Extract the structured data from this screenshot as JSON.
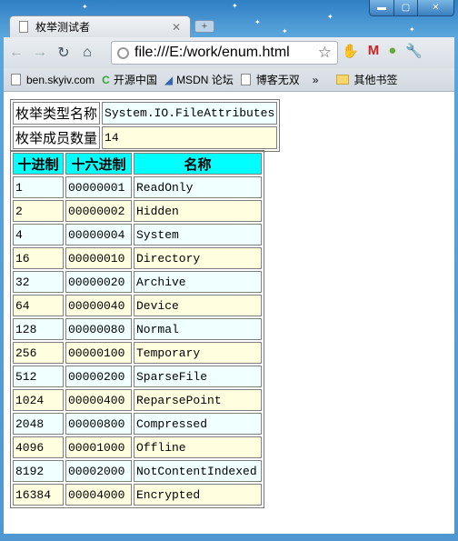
{
  "browser": {
    "tab_title": "枚举测试者",
    "url": "file:///E:/work/enum.html",
    "bookmarks": [
      "ben.skyiv.com",
      "开源中国",
      "MSDN 论坛",
      "博客无双"
    ],
    "other_bookmarks": "其他书签",
    "overflow": "»"
  },
  "summary": {
    "type_label": "枚举类型名称",
    "type_value": "System.IO.FileAttributes",
    "count_label": "枚举成员数量",
    "count_value": "14"
  },
  "table": {
    "headers": [
      "十进制",
      "十六进制",
      "名称"
    ],
    "rows": [
      [
        "1",
        "00000001",
        "ReadOnly"
      ],
      [
        "2",
        "00000002",
        "Hidden"
      ],
      [
        "4",
        "00000004",
        "System"
      ],
      [
        "16",
        "00000010",
        "Directory"
      ],
      [
        "32",
        "00000020",
        "Archive"
      ],
      [
        "64",
        "00000040",
        "Device"
      ],
      [
        "128",
        "00000080",
        "Normal"
      ],
      [
        "256",
        "00000100",
        "Temporary"
      ],
      [
        "512",
        "00000200",
        "SparseFile"
      ],
      [
        "1024",
        "00000400",
        "ReparsePoint"
      ],
      [
        "2048",
        "00000800",
        "Compressed"
      ],
      [
        "4096",
        "00001000",
        "Offline"
      ],
      [
        "8192",
        "00002000",
        "NotContentIndexed"
      ],
      [
        "16384",
        "00004000",
        "Encrypted"
      ]
    ]
  },
  "colors": {
    "header_bg": "#00ffff",
    "row_odd": "#f0ffff",
    "row_even": "#ffffe0"
  }
}
